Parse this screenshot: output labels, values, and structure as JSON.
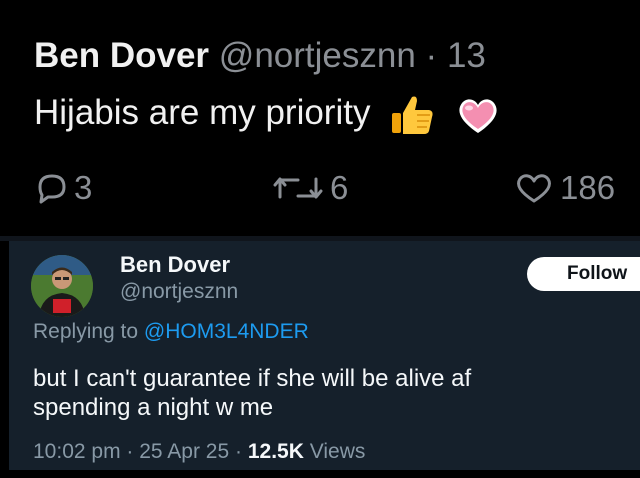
{
  "top_tweet": {
    "author_name": "Ben Dover",
    "author_handle": "@nortjesznn",
    "time_separator": "·",
    "time": "13",
    "text": "Hijabis are my priority",
    "emojis": [
      "thumbs-up-emoji",
      "pink-heart-emoji"
    ],
    "replies_count": "3",
    "retweets_count": "6",
    "likes_count": "186"
  },
  "quoted_tweet": {
    "author_name": "Ben Dover",
    "author_handle": "@nortjesznn",
    "follow_label": "Follow",
    "replying_prefix": "Replying to",
    "replying_to": "@HOM3L4NDER",
    "text_line1": "but I can't guarantee if she will be alive af",
    "text_line2": "spending a night w me",
    "time": "10:02 pm",
    "sep1": "·",
    "date": "25 Apr 25",
    "sep2": "·",
    "views_count": "12.5K",
    "views_label": "Views"
  },
  "colors": {
    "background": "#000000",
    "card_background": "#15202b",
    "accent": "#1d9bf0",
    "muted_text": "#8899a6"
  }
}
